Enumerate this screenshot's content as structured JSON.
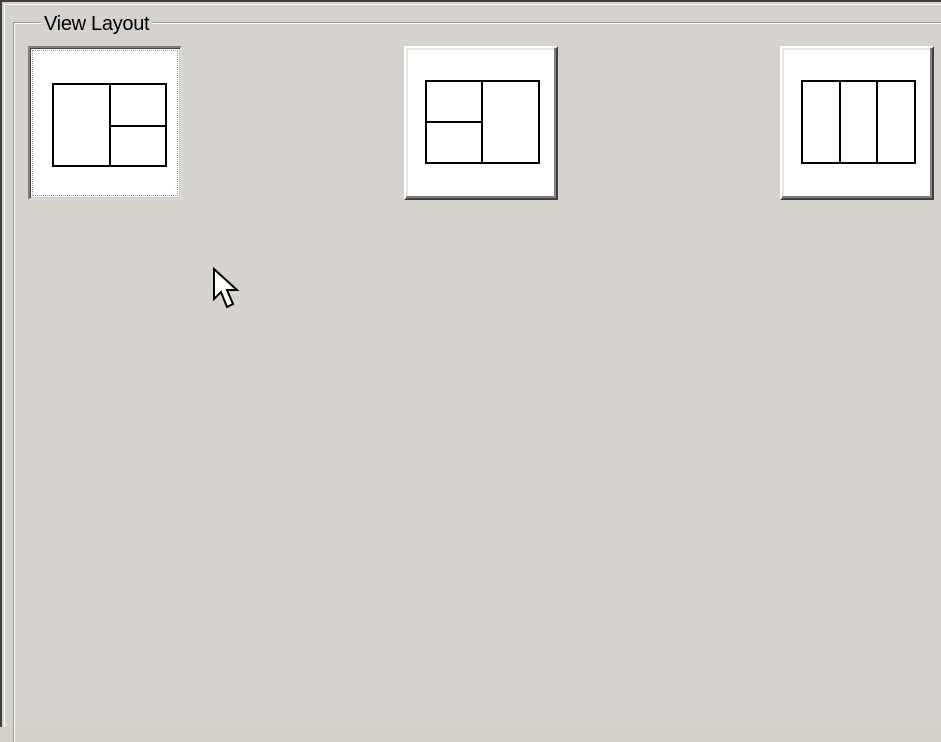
{
  "group": {
    "title": "View Layout"
  },
  "layouts": [
    {
      "name": "left-single-right-split",
      "selected": true
    },
    {
      "name": "left-split-right-single",
      "selected": false
    },
    {
      "name": "three-columns",
      "selected": false
    }
  ],
  "colors": {
    "panel_bg": "#d6d3ce",
    "button_face": "#ffffff",
    "icon_stroke": "#000000"
  },
  "icons": [
    "layout-2x1-right-split-icon",
    "layout-2x1-left-split-icon",
    "layout-3-columns-icon",
    "mouse-pointer-icon"
  ]
}
